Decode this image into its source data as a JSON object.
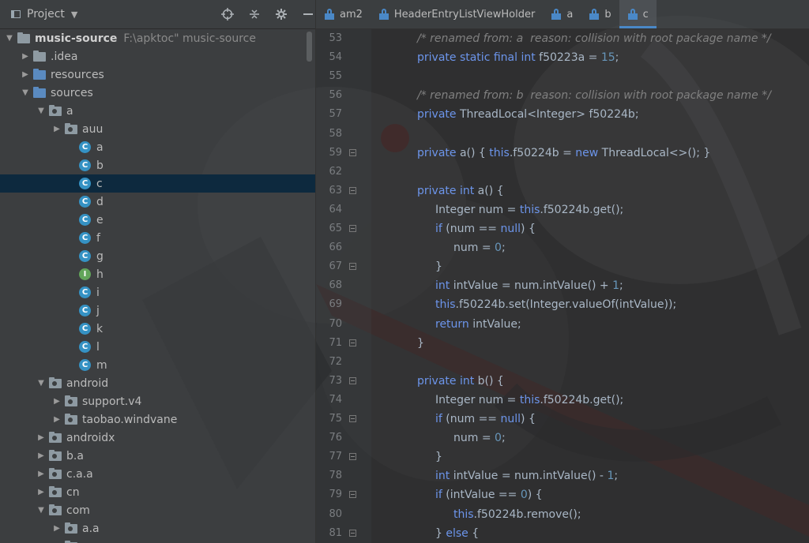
{
  "project_panel": {
    "title": "Project",
    "tools": [
      "crosshair-icon",
      "collapse-icon",
      "gear-icon",
      "minimize-icon"
    ],
    "tree": [
      {
        "label": "music-source",
        "path": "F:\\apktoc\"      music-source",
        "depth": 0,
        "arrow": "▼",
        "icon": "folder",
        "root": true
      },
      {
        "label": ".idea",
        "depth": 1,
        "arrow": "▶",
        "icon": "folder"
      },
      {
        "label": "resources",
        "depth": 1,
        "arrow": "▶",
        "icon": "folder-blue"
      },
      {
        "label": "sources",
        "depth": 1,
        "arrow": "▼",
        "icon": "folder-blue"
      },
      {
        "label": "a",
        "depth": 2,
        "arrow": "▼",
        "icon": "package"
      },
      {
        "label": "auu",
        "depth": 3,
        "arrow": "▶",
        "icon": "package"
      },
      {
        "label": "a",
        "depth": 4,
        "arrow": "",
        "icon": "class"
      },
      {
        "label": "b",
        "depth": 4,
        "arrow": "",
        "icon": "class"
      },
      {
        "label": "c",
        "depth": 4,
        "arrow": "",
        "icon": "class",
        "selected": true
      },
      {
        "label": "d",
        "depth": 4,
        "arrow": "",
        "icon": "class"
      },
      {
        "label": "e",
        "depth": 4,
        "arrow": "",
        "icon": "class"
      },
      {
        "label": "f",
        "depth": 4,
        "arrow": "",
        "icon": "class"
      },
      {
        "label": "g",
        "depth": 4,
        "arrow": "",
        "icon": "class"
      },
      {
        "label": "h",
        "depth": 4,
        "arrow": "",
        "icon": "interface"
      },
      {
        "label": "i",
        "depth": 4,
        "arrow": "",
        "icon": "class"
      },
      {
        "label": "j",
        "depth": 4,
        "arrow": "",
        "icon": "class"
      },
      {
        "label": "k",
        "depth": 4,
        "arrow": "",
        "icon": "class"
      },
      {
        "label": "l",
        "depth": 4,
        "arrow": "",
        "icon": "class"
      },
      {
        "label": "m",
        "depth": 4,
        "arrow": "",
        "icon": "class"
      },
      {
        "label": "android",
        "depth": 2,
        "arrow": "▼",
        "icon": "package"
      },
      {
        "label": "support.v4",
        "depth": 3,
        "arrow": "▶",
        "icon": "package"
      },
      {
        "label": "taobao.windvane",
        "depth": 3,
        "arrow": "▶",
        "icon": "package"
      },
      {
        "label": "androidx",
        "depth": 2,
        "arrow": "▶",
        "icon": "package"
      },
      {
        "label": "b.a",
        "depth": 2,
        "arrow": "▶",
        "icon": "package"
      },
      {
        "label": "c.a.a",
        "depth": 2,
        "arrow": "▶",
        "icon": "package"
      },
      {
        "label": "cn",
        "depth": 2,
        "arrow": "▶",
        "icon": "package"
      },
      {
        "label": "com",
        "depth": 2,
        "arrow": "▼",
        "icon": "package"
      },
      {
        "label": "a.a",
        "depth": 3,
        "arrow": "▶",
        "icon": "package"
      },
      {
        "label": "",
        "depth": 3,
        "arrow": "▶",
        "icon": "package"
      }
    ]
  },
  "tabs": [
    {
      "label": "am2",
      "active": false
    },
    {
      "label": "HeaderEntryListViewHolder",
      "active": false
    },
    {
      "label": "a",
      "active": false
    },
    {
      "label": "b",
      "active": false
    },
    {
      "label": "c",
      "active": true
    }
  ],
  "code_lines": [
    {
      "n": "53",
      "indent": 1,
      "fold": false,
      "t": [
        [
          "cm",
          "/* renamed from: a  reason: collision with root package name */"
        ]
      ]
    },
    {
      "n": "54",
      "indent": 1,
      "fold": false,
      "t": [
        [
          "kwb",
          "private static final int "
        ],
        [
          "plain",
          "f50223a = "
        ],
        [
          "num",
          "15"
        ],
        [
          "plain",
          ";"
        ]
      ]
    },
    {
      "n": "55",
      "indent": 0,
      "fold": false,
      "t": []
    },
    {
      "n": "56",
      "indent": 1,
      "fold": false,
      "t": [
        [
          "cm",
          "/* renamed from: b  reason: collision with root package name */"
        ]
      ]
    },
    {
      "n": "57",
      "indent": 1,
      "fold": false,
      "t": [
        [
          "kwb",
          "private "
        ],
        [
          "plain",
          "ThreadLocal<Integer> f50224b;"
        ]
      ]
    },
    {
      "n": "58",
      "indent": 0,
      "fold": false,
      "t": []
    },
    {
      "n": "59",
      "indent": 1,
      "fold": true,
      "t": [
        [
          "kwb",
          "private "
        ],
        [
          "plain",
          "a() { "
        ],
        [
          "kwb",
          "this"
        ],
        [
          "plain",
          ".f50224b = "
        ],
        [
          "kwb",
          "new "
        ],
        [
          "plain",
          "ThreadLocal<>(); }"
        ]
      ]
    },
    {
      "n": "62",
      "indent": 0,
      "fold": false,
      "t": []
    },
    {
      "n": "63",
      "indent": 1,
      "fold": true,
      "t": [
        [
          "kwb",
          "private int "
        ],
        [
          "plain",
          "a() {"
        ]
      ]
    },
    {
      "n": "64",
      "indent": 2,
      "fold": false,
      "t": [
        [
          "plain",
          "Integer num = "
        ],
        [
          "kwb",
          "this"
        ],
        [
          "plain",
          ".f50224b.get();"
        ]
      ]
    },
    {
      "n": "65",
      "indent": 2,
      "fold": true,
      "t": [
        [
          "kwb",
          "if "
        ],
        [
          "plain",
          "(num == "
        ],
        [
          "kwb",
          "null"
        ],
        [
          "plain",
          ") {"
        ]
      ]
    },
    {
      "n": "66",
      "indent": 3,
      "fold": false,
      "t": [
        [
          "plain",
          "num = "
        ],
        [
          "num",
          "0"
        ],
        [
          "plain",
          ";"
        ]
      ]
    },
    {
      "n": "67",
      "indent": 2,
      "fold": true,
      "t": [
        [
          "plain",
          "}"
        ]
      ]
    },
    {
      "n": "68",
      "indent": 2,
      "fold": false,
      "t": [
        [
          "kwb",
          "int "
        ],
        [
          "plain",
          "intValue = num.intValue() + "
        ],
        [
          "num",
          "1"
        ],
        [
          "plain",
          ";"
        ]
      ]
    },
    {
      "n": "69",
      "indent": 2,
      "fold": false,
      "t": [
        [
          "kwb",
          "this"
        ],
        [
          "plain",
          ".f50224b.set(Integer.valueOf(intValue));"
        ]
      ]
    },
    {
      "n": "70",
      "indent": 2,
      "fold": false,
      "t": [
        [
          "kwb",
          "return "
        ],
        [
          "plain",
          "intValue;"
        ]
      ]
    },
    {
      "n": "71",
      "indent": 1,
      "fold": true,
      "t": [
        [
          "plain",
          "}"
        ]
      ]
    },
    {
      "n": "72",
      "indent": 0,
      "fold": false,
      "t": []
    },
    {
      "n": "73",
      "indent": 1,
      "fold": true,
      "t": [
        [
          "kwb",
          "private int "
        ],
        [
          "plain",
          "b() {"
        ]
      ]
    },
    {
      "n": "74",
      "indent": 2,
      "fold": false,
      "t": [
        [
          "plain",
          "Integer num = "
        ],
        [
          "kwb",
          "this"
        ],
        [
          "plain",
          ".f50224b.get();"
        ]
      ]
    },
    {
      "n": "75",
      "indent": 2,
      "fold": true,
      "t": [
        [
          "kwb",
          "if "
        ],
        [
          "plain",
          "(num == "
        ],
        [
          "kwb",
          "null"
        ],
        [
          "plain",
          ") {"
        ]
      ]
    },
    {
      "n": "76",
      "indent": 3,
      "fold": false,
      "t": [
        [
          "plain",
          "num = "
        ],
        [
          "num",
          "0"
        ],
        [
          "plain",
          ";"
        ]
      ]
    },
    {
      "n": "77",
      "indent": 2,
      "fold": true,
      "t": [
        [
          "plain",
          "}"
        ]
      ]
    },
    {
      "n": "78",
      "indent": 2,
      "fold": false,
      "t": [
        [
          "kwb",
          "int "
        ],
        [
          "plain",
          "intValue = num.intValue() - "
        ],
        [
          "num",
          "1"
        ],
        [
          "plain",
          ";"
        ]
      ]
    },
    {
      "n": "79",
      "indent": 2,
      "fold": true,
      "t": [
        [
          "kwb",
          "if "
        ],
        [
          "plain",
          "(intValue == "
        ],
        [
          "num",
          "0"
        ],
        [
          "plain",
          ") {"
        ]
      ]
    },
    {
      "n": "80",
      "indent": 3,
      "fold": false,
      "t": [
        [
          "kwb",
          "this"
        ],
        [
          "plain",
          ".f50224b.remove();"
        ]
      ]
    },
    {
      "n": "81",
      "indent": 2,
      "fold": true,
      "t": [
        [
          "plain",
          "} "
        ],
        [
          "kwb",
          "else "
        ],
        [
          "plain",
          "{"
        ]
      ]
    }
  ],
  "colors": {
    "accent": "#4a88c7",
    "selection": "#0d293e"
  }
}
